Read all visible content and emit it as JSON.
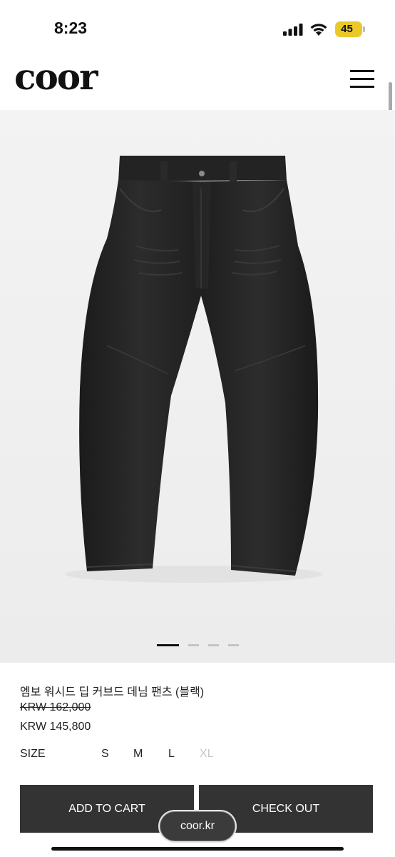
{
  "status_bar": {
    "time": "8:23",
    "battery": "45",
    "icons": [
      "signal-bars-icon",
      "wifi-icon",
      "battery-icon"
    ]
  },
  "header": {
    "logo": "coor",
    "menu_icon": "hamburger-menu-icon"
  },
  "gallery": {
    "image": "black-curved-denim-pants-photo",
    "slide_count": 4,
    "active_slide": 1
  },
  "product": {
    "name": "엠보 워시드 딥 커브드 데님 팬츠 (블랙)",
    "original_price": "KRW 162,000",
    "sale_price": "KRW 145,800"
  },
  "size": {
    "label": "SIZE",
    "options": [
      {
        "label": "S",
        "available": true
      },
      {
        "label": "M",
        "available": true
      },
      {
        "label": "L",
        "available": true
      },
      {
        "label": "XL",
        "available": false
      }
    ]
  },
  "actions": {
    "add_to_cart": "ADD TO CART",
    "check_out": "CHECK OUT"
  },
  "browser": {
    "url": "coor.kr"
  },
  "colors": {
    "button_bg": "#333333",
    "gallery_bg": "#f1f1f1",
    "battery": "#e9c92a",
    "disabled_text": "#c8c8c8"
  }
}
